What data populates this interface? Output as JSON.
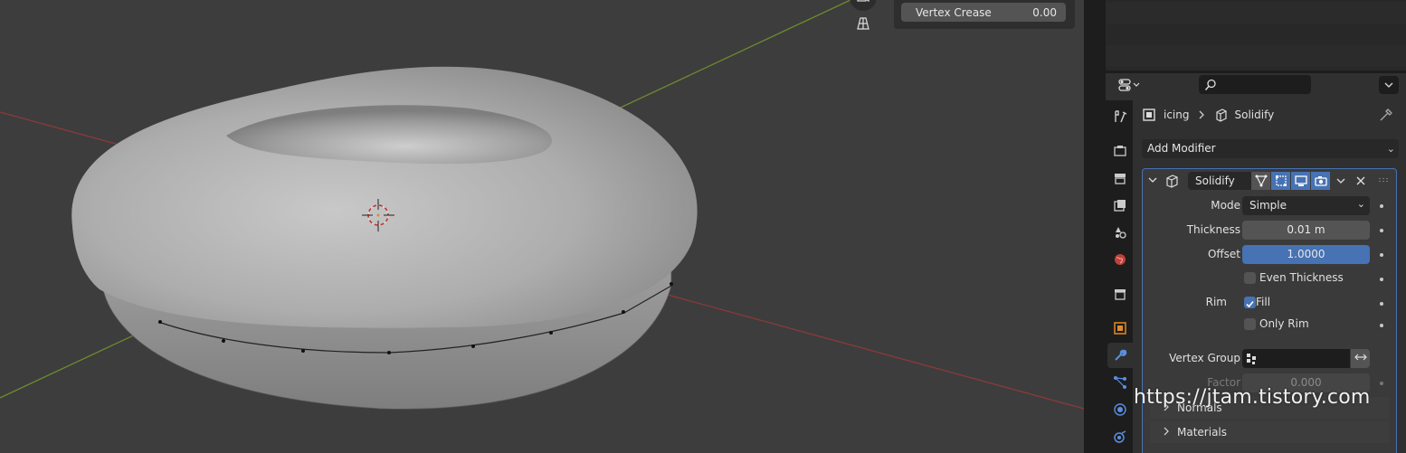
{
  "viewport": {
    "redo_panel": {
      "vertex_crease_label": "Vertex Crease",
      "vertex_crease_value": "0.00"
    }
  },
  "properties": {
    "search": {
      "placeholder": ""
    },
    "breadcrumb": {
      "object": "icing",
      "modifier": "Solidify"
    },
    "add_modifier": "Add Modifier",
    "modifier": {
      "name": "Solidify",
      "mode_label": "Mode",
      "mode_value": "Simple",
      "thickness_label": "Thickness",
      "thickness_value": "0.01 m",
      "offset_label": "Offset",
      "offset_value": "1.0000",
      "even_thickness": "Even Thickness",
      "rim_label": "Rim",
      "fill": "Fill",
      "only_rim": "Only Rim",
      "vertex_group_label": "Vertex Group",
      "factor_label": "Factor",
      "factor_value": "0.000",
      "normals": "Normals",
      "materials": "Materials"
    }
  },
  "watermark": "https://jtam.tistory.com",
  "colors": {
    "accent": "#4772b3",
    "panel": "#303030",
    "viewport": "#3d3d3d"
  }
}
